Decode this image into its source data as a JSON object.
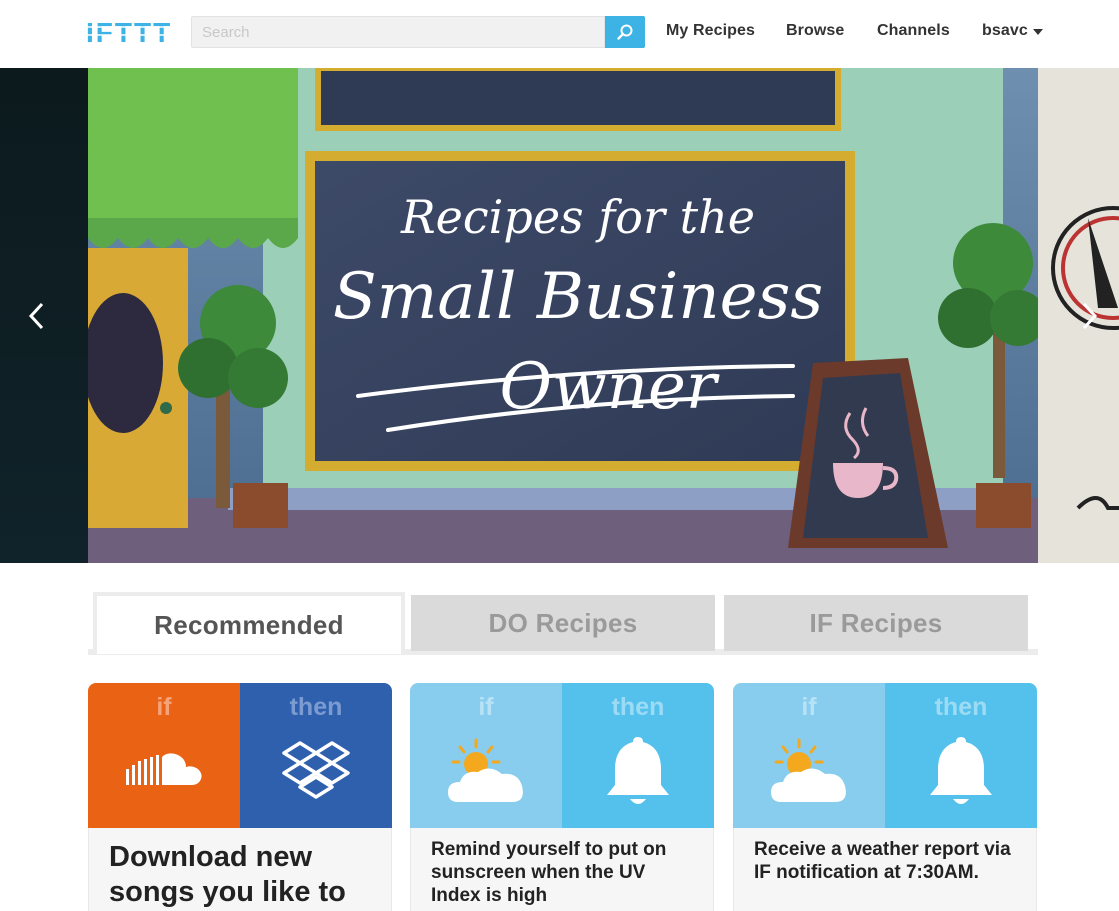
{
  "header": {
    "logo_text": "IFTTT",
    "search_placeholder": "Search",
    "nav": [
      "My Recipes",
      "Browse",
      "Channels"
    ],
    "username": "bsavc"
  },
  "hero": {
    "heading_line1": "Recipes for the",
    "heading_line2": "Small Business",
    "heading_line3": "Owner"
  },
  "tabs": [
    {
      "label": "Recommended",
      "active": true
    },
    {
      "label": "DO Recipes",
      "active": false
    },
    {
      "label": "IF Recipes",
      "active": false
    }
  ],
  "cards": [
    {
      "if_label": "if",
      "then_label": "then",
      "if_channel": "soundcloud-icon",
      "then_channel": "dropbox-icon",
      "title": "Download new songs you like to",
      "colors": {
        "if": "#ea6214",
        "then": "#2f60ad"
      }
    },
    {
      "if_label": "if",
      "then_label": "then",
      "if_channel": "weather-icon",
      "then_channel": "bell-icon",
      "title": "Remind yourself to put on sunscreen when the UV Index is high",
      "colors": {
        "if": "#89cdee",
        "then": "#54c1ed"
      }
    },
    {
      "if_label": "if",
      "then_label": "then",
      "if_channel": "weather-icon",
      "then_channel": "bell-icon",
      "title": "Receive a weather report via IF notification at 7:30AM.",
      "colors": {
        "if": "#89cdee",
        "then": "#54c1ed"
      }
    }
  ],
  "colors": {
    "brand": "#3cb2e5",
    "tab_inactive": "#dadada"
  }
}
